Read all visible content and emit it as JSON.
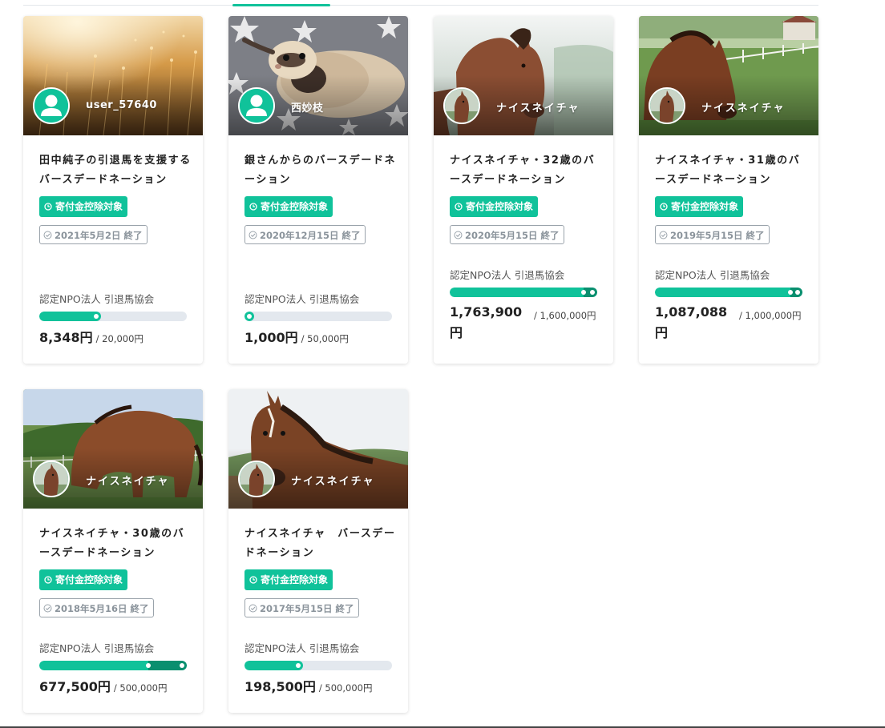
{
  "cards": [
    {
      "owner": "user_57640",
      "title": "田中純子の引退馬を支援するバースデードネーション",
      "deduct_label": "寄付金控除対象",
      "end_label": "2021年5月2日 終了",
      "org": "認定NPO法人 引退馬協会",
      "amount": "8,348円",
      "goal": "/ 20,000円",
      "progress": 0.42
    },
    {
      "owner": "西妙枝",
      "title": "銀さんからのバースデードネーション",
      "deduct_label": "寄付金控除対象",
      "end_label": "2020年12月15日 終了",
      "org": "認定NPO法人 引退馬協会",
      "amount": "1,000円",
      "goal": "/ 50,000円",
      "progress": 0.04
    },
    {
      "owner": "ナイスネイチャ",
      "title": "ナイスネイチャ・32歳のバースデードネーション",
      "deduct_label": "寄付金控除対象",
      "end_label": "2020年5月15日 終了",
      "org": "認定NPO法人 引退馬協会",
      "amount": "1,763,900円",
      "goal": "/ 1,600,000円",
      "progress": 1.102
    },
    {
      "owner": "ナイスネイチャ",
      "title": "ナイスネイチャ・31歳のバースデードネーション",
      "deduct_label": "寄付金控除対象",
      "end_label": "2019年5月15日 終了",
      "org": "認定NPO法人 引退馬協会",
      "amount": "1,087,088円",
      "goal": "/ 1,000,000円",
      "progress": 1.087
    },
    {
      "owner": "ナイスネイチャ",
      "title": "ナイスネイチャ・30歳のバースデードネーション",
      "deduct_label": "寄付金控除対象",
      "end_label": "2018年5月16日 終了",
      "org": "認定NPO法人 引退馬協会",
      "amount": "677,500円",
      "goal": "/ 500,000円",
      "progress": 1.355
    },
    {
      "owner": "ナイスネイチャ",
      "title": "ナイスネイチャ　バースデードネーション",
      "deduct_label": "寄付金控除対象",
      "end_label": "2017年5月15日 終了",
      "org": "認定NPO法人 引退馬協会",
      "amount": "198,500円",
      "goal": "/ 500,000円",
      "progress": 0.397
    }
  ],
  "colors": {
    "accent": "#10c29a",
    "accent_dark": "#0a8f6f",
    "track": "#e3e8ee",
    "end_badge": "#8a939b"
  },
  "icons": {
    "deduct": "clock-icon",
    "ended": "check-circle-icon",
    "default_avatar": "user-silhouette-icon"
  }
}
